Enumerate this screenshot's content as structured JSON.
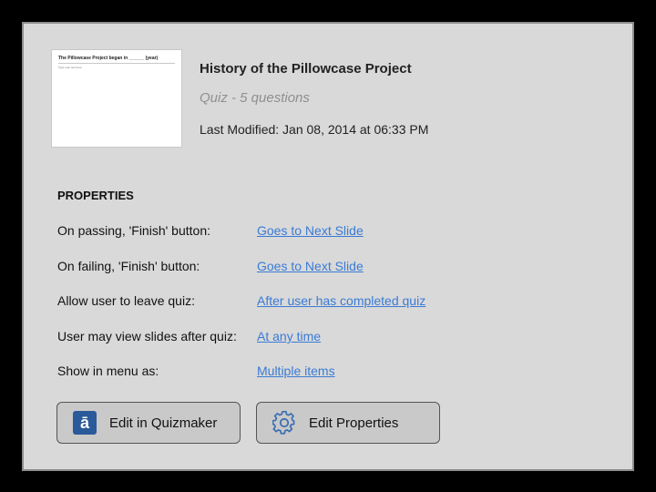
{
  "thumbnail": {
    "title": "The Pillowcase Project began in ______ (year)",
    "subtitle": "Type your text here"
  },
  "header": {
    "title": "History of the Pillowcase Project",
    "subtitle": "Quiz - 5 questions",
    "last_modified": "Last Modified: Jan 08, 2014 at 06:33 PM"
  },
  "properties": {
    "heading": "PROPERTIES",
    "rows": [
      {
        "label": "On passing, 'Finish' button:",
        "value": "Goes to Next Slide"
      },
      {
        "label": "On failing, 'Finish' button:",
        "value": "Goes to Next Slide"
      },
      {
        "label": "Allow user to leave quiz:",
        "value": "After user has completed quiz"
      },
      {
        "label": "User may view slides after quiz:",
        "value": "At any time"
      },
      {
        "label": "Show in menu as:",
        "value": "Multiple items"
      }
    ]
  },
  "buttons": {
    "edit_quizmaker": "Edit in Quizmaker",
    "edit_quizmaker_icon": "ā",
    "edit_properties": "Edit Properties"
  },
  "colors": {
    "link": "#3a7bd5",
    "panel_bg": "#d9d9d9",
    "button_bg": "#c9c9c9",
    "quizmaker_icon_bg": "#2b5a9a"
  }
}
